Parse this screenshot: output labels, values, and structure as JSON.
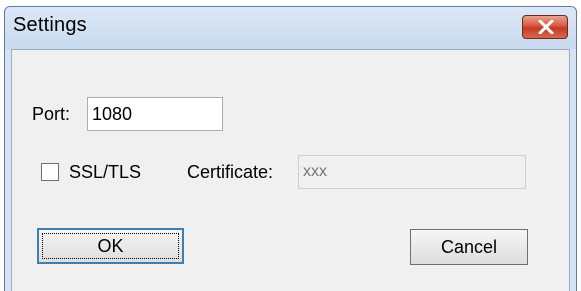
{
  "window": {
    "title": "Settings",
    "close_icon": "close-icon"
  },
  "form": {
    "port_label": "Port:",
    "port_value": "1080",
    "ssl_label": "SSL/TLS",
    "ssl_checked": false,
    "certificate_label": "Certificate:",
    "certificate_placeholder": "xxx"
  },
  "buttons": {
    "ok_label": "OK",
    "cancel_label": "Cancel"
  },
  "colors": {
    "titlebar": "#d5e3f3",
    "close_button": "#c8432b",
    "client_bg": "#f0f0f0",
    "default_button_border": "#3c7fb1"
  }
}
